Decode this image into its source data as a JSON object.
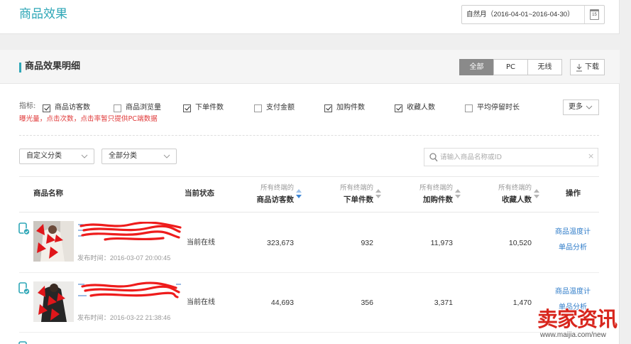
{
  "colors": {
    "accent": "#2fa7b7",
    "link": "#2f7cc9",
    "notice": "#e03b3b",
    "tab_active_bg": "#8a8a8a",
    "sort_active": "#3d86d6",
    "watermark": "#d8261d"
  },
  "header": {
    "title": "商品效果",
    "date_range": "自然月（2016-04-01~2016-04-30）",
    "calendar_icon": "calendar-icon",
    "calendar_icon_day": "15"
  },
  "detail": {
    "title": "商品效果明细",
    "device_tabs": [
      {
        "label": "全部",
        "active": true
      },
      {
        "label": "PC",
        "active": false
      },
      {
        "label": "无线",
        "active": false
      }
    ],
    "download_label": "下载",
    "download_icon": "download-icon"
  },
  "metrics": {
    "label": "指标:",
    "options": [
      {
        "label": "商品访客数",
        "checked": true
      },
      {
        "label": "商品浏览量",
        "checked": false
      },
      {
        "label": "下单件数",
        "checked": true
      },
      {
        "label": "支付金额",
        "checked": false
      },
      {
        "label": "加购件数",
        "checked": true
      },
      {
        "label": "收藏人数",
        "checked": true
      },
      {
        "label": "平均停留时长",
        "checked": false
      }
    ],
    "more_label": "更多",
    "more_icon": "chevron-down-icon",
    "notice": "曝光量，点击次数，点击率暂只提供PC端数据"
  },
  "filters": {
    "custom_category": "自定义分类",
    "all_category": "全部分类",
    "search_placeholder": "请输入商品名称或ID",
    "search_icon": "search-icon",
    "clear_icon": "close-icon"
  },
  "table": {
    "headers": {
      "name": "商品名称",
      "status": "当前状态",
      "operations": "操作",
      "metrics": [
        {
          "prefix": "所有终端的",
          "label": "商品访客数",
          "sorted": true
        },
        {
          "prefix": "所有终端的",
          "label": "下单件数",
          "sorted": false
        },
        {
          "prefix": "所有终端的",
          "label": "加购件数",
          "sorted": false
        },
        {
          "prefix": "所有终端的",
          "label": "收藏人数",
          "sorted": false
        }
      ]
    },
    "rows": [
      {
        "device_icon": "mobile-check-icon",
        "publish_time": "发布时间：2016-03-07 20:00:45",
        "status": "当前在线",
        "values": [
          "323,673",
          "932",
          "11,973",
          "10,520"
        ],
        "actions": [
          "商品温度计",
          "单品分析"
        ]
      },
      {
        "device_icon": "mobile-check-icon",
        "publish_time": "发布时间：2016-03-22 21:38:46",
        "status": "当前在线",
        "values": [
          "44,693",
          "356",
          "3,371",
          "1,470"
        ],
        "actions": [
          "商品温度计",
          "单品分析"
        ]
      }
    ]
  },
  "watermark": {
    "brand": "卖家资讯",
    "url": "www.maijia.com/new"
  }
}
